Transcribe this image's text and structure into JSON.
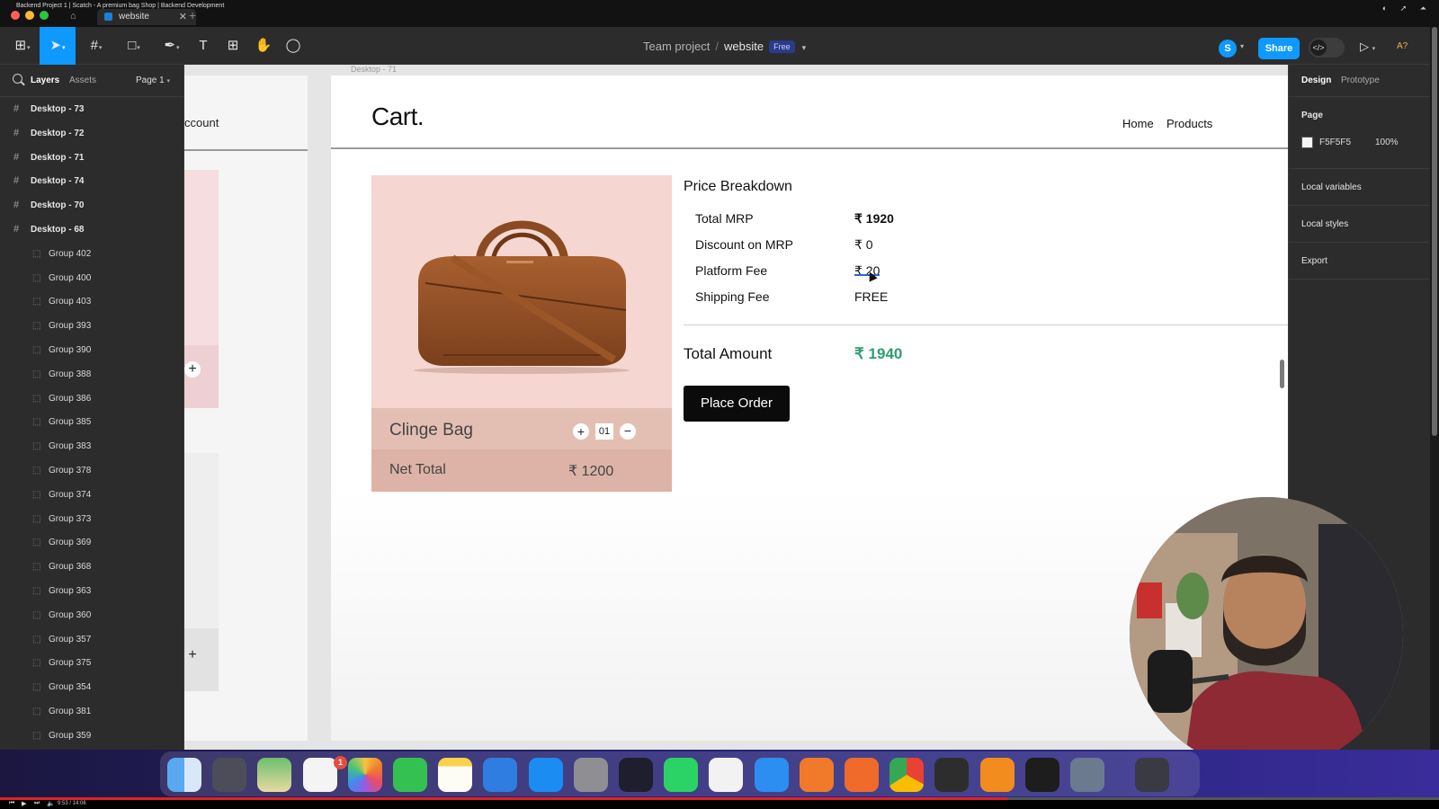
{
  "browser": {
    "window_title": "Backend Project 1 | Scatch - A premium bag Shop | Backend Development",
    "tab_label": "website"
  },
  "toolbar": {
    "team": "Team project",
    "file": "website",
    "plan_badge": "Free",
    "avatar_initial": "S",
    "share_label": "Share",
    "zoom_label": "A?"
  },
  "left_panel": {
    "tabs": {
      "layers": "Layers",
      "assets": "Assets"
    },
    "page_selector": "Page 1",
    "frames": [
      "Desktop - 73",
      "Desktop - 72",
      "Desktop - 71",
      "Desktop - 74",
      "Desktop - 70",
      "Desktop - 68"
    ],
    "groups": [
      "Group 402",
      "Group 400",
      "Group 403",
      "Group 393",
      "Group 390",
      "Group 388",
      "Group 386",
      "Group 385",
      "Group 383",
      "Group 378",
      "Group 374",
      "Group 373",
      "Group 369",
      "Group 368",
      "Group 363",
      "Group 360",
      "Group 357",
      "Group 375",
      "Group 354",
      "Group 381",
      "Group 359"
    ]
  },
  "canvas": {
    "left_frame_text": "ccount",
    "frame_label": "Desktop - 71",
    "logo": "Cart.",
    "nav": {
      "home": "Home",
      "products": "Products"
    },
    "product": {
      "name": "Clinge Bag",
      "qty": "01",
      "net_total_label": "Net Total",
      "net_total_value": "₹ 1200"
    },
    "breakdown": {
      "title": "Price Breakdown",
      "rows": [
        {
          "label": "Total MRP",
          "value": "₹ 1920"
        },
        {
          "label": "Discount on MRP",
          "value": "₹ 0"
        },
        {
          "label": "Platform Fee",
          "value": "₹ 20"
        },
        {
          "label": "Shipping Fee",
          "value": "FREE"
        }
      ],
      "total_label": "Total Amount",
      "total_value": "₹ 1940",
      "place_order": "Place Order"
    }
  },
  "right_panel": {
    "tabs": {
      "design": "Design",
      "prototype": "Prototype"
    },
    "page_section": "Page",
    "page_color": "F5F5F5",
    "page_opacity": "100%",
    "local_variables": "Local variables",
    "local_styles": "Local styles",
    "export": "Export"
  },
  "player": {
    "time": "9:53 / 14:06",
    "progress": 0.7
  },
  "colors": {
    "figma_blue": "#0d99ff",
    "product_bg": "#f5d6d0",
    "total_green": "#2e9e6f"
  }
}
